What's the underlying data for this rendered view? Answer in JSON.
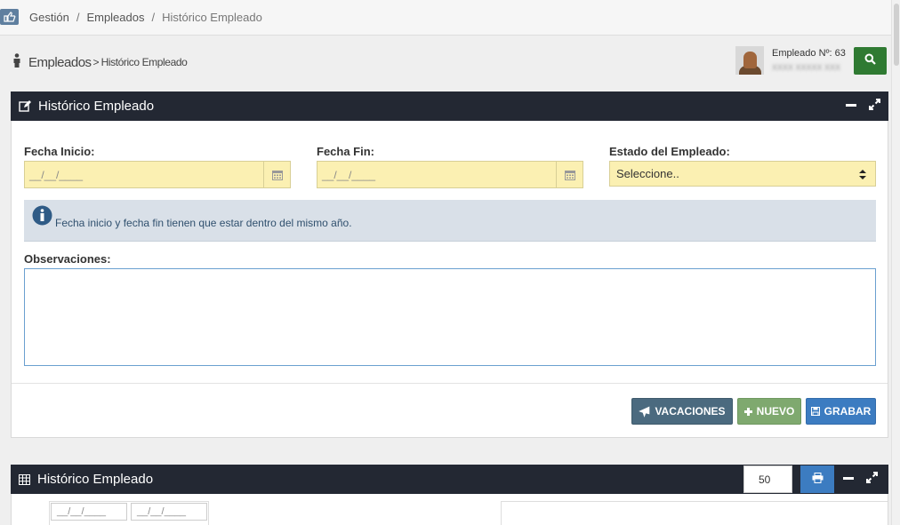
{
  "breadcrumb": {
    "items": [
      "Gestión",
      "Empleados",
      "Histórico Empleado"
    ],
    "separator": "/"
  },
  "page_header": {
    "title": "Empleados",
    "arrow": ">",
    "subtitle": "Histórico Empleado"
  },
  "employee": {
    "number_label": "Empleado Nº: 63",
    "name_blurred": "XXXX XXXXX XXX"
  },
  "form_panel": {
    "title": "Histórico Empleado",
    "fecha_inicio_label": "Fecha Inicio:",
    "fecha_inicio_value": "__/__/____",
    "fecha_fin_label": "Fecha Fin:",
    "fecha_fin_value": "__/__/____",
    "estado_label": "Estado del Empleado:",
    "estado_value": "Seleccione..",
    "info_text": "Fecha inicio y fecha fin tienen que estar dentro del mismo año.",
    "observaciones_label": "Observaciones:",
    "buttons": {
      "vacaciones": "VACACIONES",
      "nuevo": "NUEVO",
      "grabar": "GRABAR"
    }
  },
  "list_panel": {
    "title": "Histórico Empleado",
    "page_size": "50",
    "filters": [
      "__/__/____",
      "__/__/____"
    ]
  },
  "colors": {
    "panel_header": "#232833",
    "input_highlight": "#fbf0b2",
    "search_button": "#2f7a32",
    "vacaciones_button": "#4b6a7f",
    "nuevo_button": "#7fa96f",
    "grabar_button": "#3c7cc1",
    "info_background": "#d9e0e8"
  },
  "icons": {
    "top_button": "hand-pointer-icon",
    "page_header": "person-icon",
    "search": "search-icon",
    "form_panel": "edit-icon",
    "calendar": "calendar-icon",
    "select": "sort-arrows-icon",
    "info": "info-circle-icon",
    "vacaciones": "plane-icon",
    "nuevo": "plus-icon",
    "grabar": "save-icon",
    "list_panel": "table-icon",
    "print": "print-icon",
    "minimize": "minimize-icon",
    "expand": "expand-icon"
  }
}
